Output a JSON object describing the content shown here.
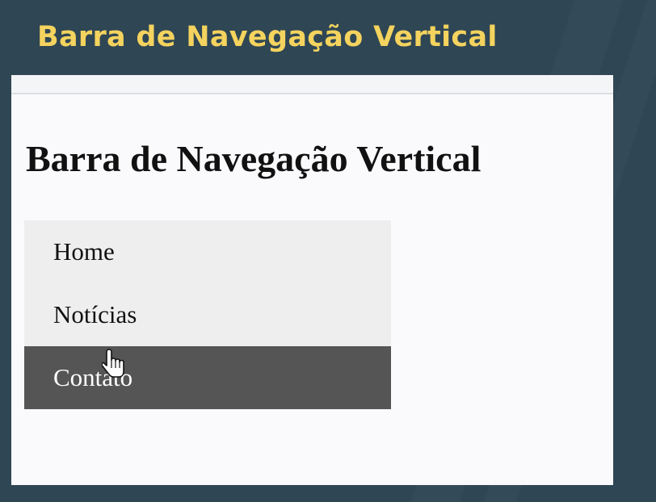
{
  "slide": {
    "title": "Barra de Navegação Vertical",
    "title_color": "#f4d35e",
    "background_color": "#2f4654"
  },
  "page": {
    "heading": "Barra de Navegação Vertical",
    "background_color": "#fafafd"
  },
  "nav": {
    "background_color": "#eeeeee",
    "hover_background_color": "#555555",
    "hover_text_color": "#ffffff",
    "items": [
      {
        "label": "Home",
        "hovered": false
      },
      {
        "label": "Notícias",
        "hovered": false
      },
      {
        "label": "Contato",
        "hovered": true
      }
    ]
  },
  "cursor": {
    "icon": "hand-pointer-icon"
  }
}
